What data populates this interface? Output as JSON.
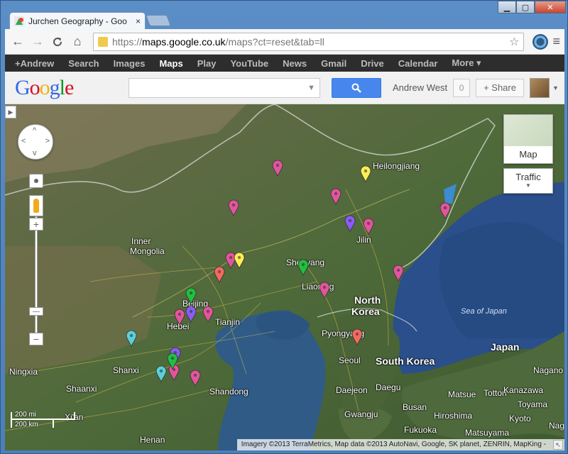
{
  "tab": {
    "title": "Jurchen Geography - Goo",
    "close": "×"
  },
  "window": {
    "minimize": "▁",
    "maximize": "▢",
    "close": "✕"
  },
  "toolbar": {
    "back": "←",
    "forward": "→",
    "reload": "C",
    "home": "⌂",
    "url_prefix": "https://",
    "url_host": "maps.google.co.uk",
    "url_rest": "/maps?ct=reset&tab=ll",
    "star": "☆",
    "menu": "≡"
  },
  "gbar": [
    "+Andrew",
    "Search",
    "Images",
    "Maps",
    "Play",
    "YouTube",
    "News",
    "Gmail",
    "Drive",
    "Calendar",
    "More ▾"
  ],
  "gbar_active": "Maps",
  "header": {
    "logo": [
      "G",
      "o",
      "o",
      "g",
      "l",
      "e"
    ],
    "search_value": "",
    "search_caret": "▼",
    "search_icon": "⚲",
    "user_name": "Andrew West",
    "notification_count": "0",
    "share_label": "+  Share"
  },
  "map": {
    "type_label": "Map",
    "traffic_label": "Traffic",
    "scale_mi": "200 mi",
    "scale_km": "200 km",
    "attribution": "Imagery ©2013 TerraMetrics, Map data ©2013 AutoNavi, Google, SK planet, ZENRIN, MapKing -",
    "labels": [
      {
        "text": "Heilongjiang",
        "style": "normal"
      },
      {
        "text": "Inner",
        "style": "normal"
      },
      {
        "text": "Mongolia",
        "style": "normal"
      },
      {
        "text": "Jilin",
        "style": "normal"
      },
      {
        "text": "Shenyang",
        "style": "normal"
      },
      {
        "text": "Liaoning",
        "style": "normal"
      },
      {
        "text": "North",
        "style": "big"
      },
      {
        "text": "Korea",
        "style": "big"
      },
      {
        "text": "Beijing",
        "style": "normal"
      },
      {
        "text": "Hebei",
        "style": "normal"
      },
      {
        "text": "Tianjin",
        "style": "normal"
      },
      {
        "text": "Pyongyang",
        "style": "normal"
      },
      {
        "text": "Sea of Japan",
        "style": "sea"
      },
      {
        "text": "Japan",
        "style": "big"
      },
      {
        "text": "Ningxia",
        "style": "normal"
      },
      {
        "text": "Shanxi",
        "style": "normal"
      },
      {
        "text": "Shaanxi",
        "style": "normal"
      },
      {
        "text": "Seoul",
        "style": "normal"
      },
      {
        "text": "South Korea",
        "style": "big"
      },
      {
        "text": "Shandong",
        "style": "normal"
      },
      {
        "text": "Daejeon",
        "style": "normal"
      },
      {
        "text": "Daegu",
        "style": "normal"
      },
      {
        "text": "Gwangju",
        "style": "normal"
      },
      {
        "text": "Busan",
        "style": "normal"
      },
      {
        "text": "Matsue",
        "style": "normal"
      },
      {
        "text": "Tottori",
        "style": "normal"
      },
      {
        "text": "Kanazawa",
        "style": "normal"
      },
      {
        "text": "Nagano",
        "style": "normal"
      },
      {
        "text": "Hiroshima",
        "style": "normal"
      },
      {
        "text": "Fukuoka",
        "style": "normal"
      },
      {
        "text": "Matsuyama",
        "style": "normal"
      },
      {
        "text": "Henan",
        "style": "normal"
      },
      {
        "text": "Xi'an",
        "style": "normal"
      },
      {
        "text": "Kyoto",
        "style": "normal"
      },
      {
        "text": "Toyama",
        "style": "normal"
      },
      {
        "text": "Nag",
        "style": "normal"
      }
    ],
    "pins": [
      {
        "color": "#e2559c"
      },
      {
        "color": "#e2559c"
      },
      {
        "color": "#e2559c"
      },
      {
        "color": "#e2559c"
      },
      {
        "color": "#e2559c"
      },
      {
        "color": "#e2559c"
      },
      {
        "color": "#e2559c"
      },
      {
        "color": "#e2559c"
      },
      {
        "color": "#e2559c"
      },
      {
        "color": "#e2559c"
      },
      {
        "color": "#e2559c"
      },
      {
        "color": "#e2559c"
      },
      {
        "color": "#e2559c"
      },
      {
        "color": "#8b5cf6"
      },
      {
        "color": "#8b5cf6"
      },
      {
        "color": "#8b5cf6"
      },
      {
        "color": "#ffee55"
      },
      {
        "color": "#ffee55"
      },
      {
        "color": "#20c040"
      },
      {
        "color": "#20c040"
      },
      {
        "color": "#20c040"
      },
      {
        "color": "#f26b5e"
      },
      {
        "color": "#f26b5e"
      },
      {
        "color": "#5cd0d8"
      },
      {
        "color": "#5cd0d8"
      }
    ]
  }
}
